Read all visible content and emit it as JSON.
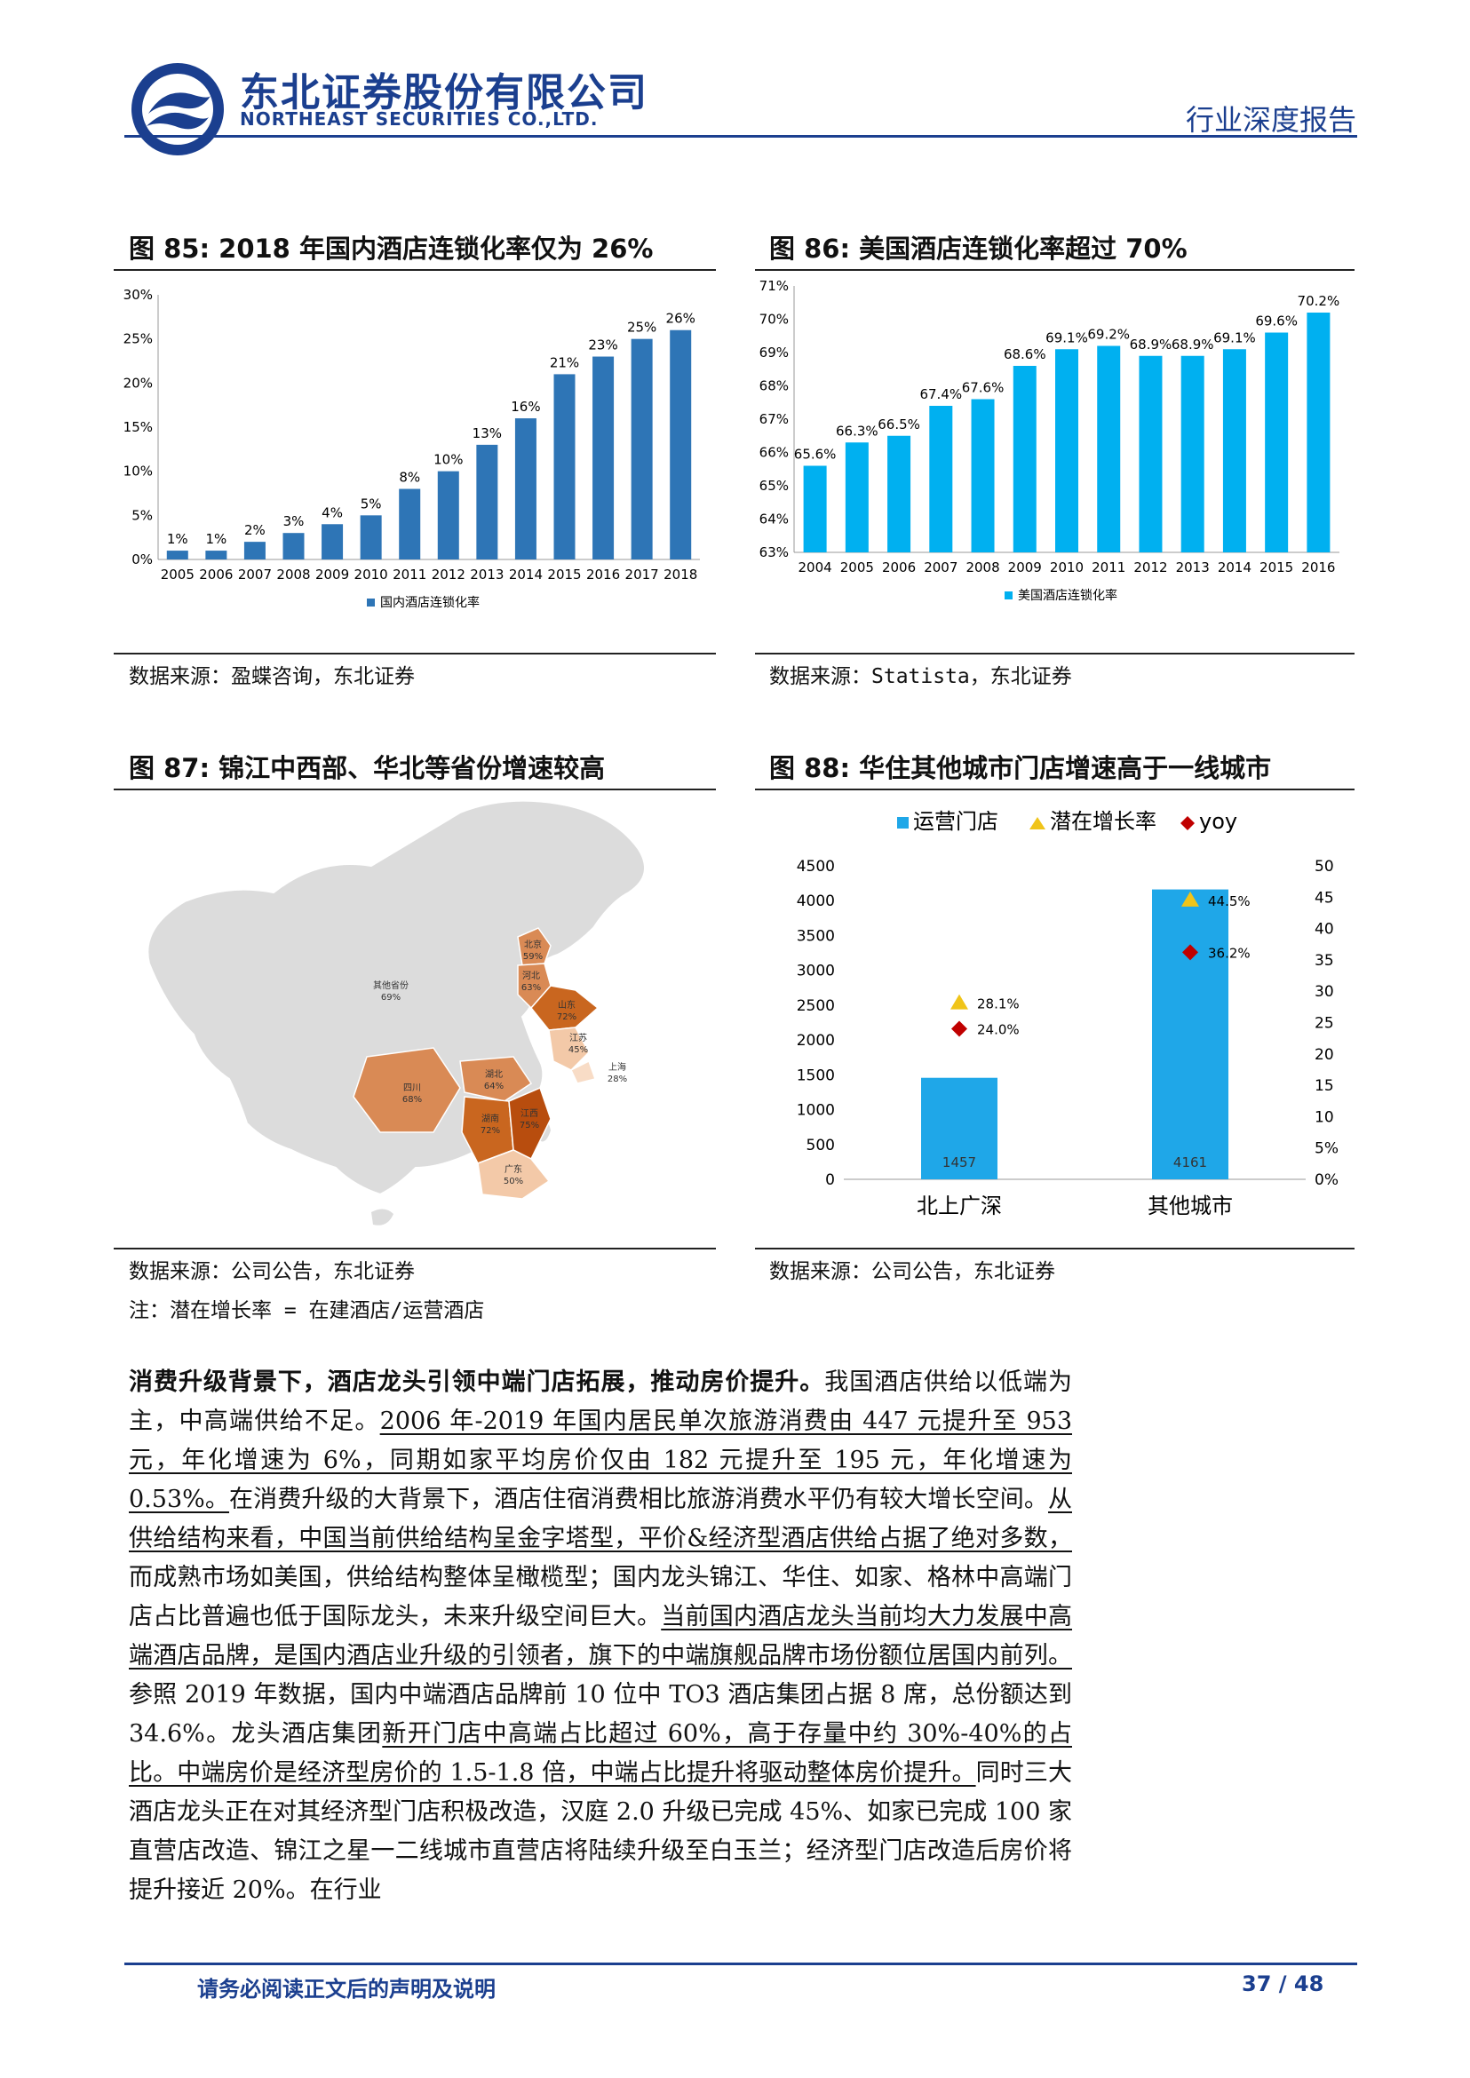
{
  "header": {
    "company_cn": "东北证券股份有限公司",
    "company_en": "NORTHEAST SECURITIES CO.,LTD.",
    "report_type": "行业深度报告",
    "brand_color": "#1b3f8f",
    "logo_icon": "northeast-securities-logo"
  },
  "fig85": {
    "title": "图 85: 2018 年国内酒店连锁化率仅为 26%",
    "source": "数据来源：盈蝶咨询，东北证券"
  },
  "fig86": {
    "title": "图 86: 美国酒店连锁化率超过 70%",
    "source": "数据来源：Statista，东北证券"
  },
  "fig87": {
    "title": "图 87: 锦江中西部、华北等省份增速较高",
    "source": "数据来源：公司公告，东北证券",
    "note": "注：潜在增长率 = 在建酒店/运营酒店",
    "regions": [
      {
        "name": "北京",
        "value": "59%",
        "color": "#d98a55"
      },
      {
        "name": "河北",
        "value": "63%",
        "color": "#d98a55"
      },
      {
        "name": "山东",
        "value": "72%",
        "color": "#c9661f"
      },
      {
        "name": "江苏",
        "value": "45%",
        "color": "#f3c9a8"
      },
      {
        "name": "上海",
        "value": "28%",
        "color": "#f8dcc6"
      },
      {
        "name": "其他省份",
        "value": "69%",
        "color": "#dcdcdc"
      },
      {
        "name": "四川",
        "value": "68%",
        "color": "#d98a55"
      },
      {
        "name": "湖北",
        "value": "64%",
        "color": "#d98a55"
      },
      {
        "name": "湖南",
        "value": "72%",
        "color": "#c9661f"
      },
      {
        "name": "江西",
        "value": "75%",
        "color": "#b84d0e"
      },
      {
        "name": "广东",
        "value": "50%",
        "color": "#f3c9a8"
      }
    ]
  },
  "fig88": {
    "title": "图 88: 华住其他城市门店增速高于一线城市",
    "source": "数据来源：公司公告，东北证券"
  },
  "chart_data": [
    {
      "type": "bar",
      "categories": [
        "2005",
        "2006",
        "2007",
        "2008",
        "2009",
        "2010",
        "2011",
        "2012",
        "2013",
        "2014",
        "2015",
        "2016",
        "2017",
        "2018"
      ],
      "series": [
        {
          "name": "国内酒店连锁化率",
          "values": [
            1,
            1,
            2,
            3,
            4,
            5,
            8,
            10,
            13,
            16,
            21,
            23,
            25,
            26
          ]
        }
      ],
      "data_labels": [
        "1%",
        "1%",
        "2%",
        "3%",
        "4%",
        "5%",
        "8%",
        "10%",
        "13%",
        "16%",
        "21%",
        "23%",
        "25%",
        "26%"
      ],
      "ylim": [
        0,
        30
      ],
      "yticks": [
        "0%",
        "5%",
        "10%",
        "15%",
        "20%",
        "25%",
        "30%"
      ],
      "color": "#2e75b6",
      "legend": "bottom-center",
      "grid": false
    },
    {
      "type": "bar",
      "categories": [
        "2004",
        "2005",
        "2006",
        "2007",
        "2008",
        "2009",
        "2010",
        "2011",
        "2012",
        "2013",
        "2014",
        "2015",
        "2016"
      ],
      "series": [
        {
          "name": "美国酒店连锁化率",
          "values": [
            65.6,
            66.3,
            66.5,
            67.4,
            67.6,
            68.6,
            69.1,
            69.2,
            68.9,
            68.9,
            69.1,
            69.6,
            70.2
          ]
        }
      ],
      "data_labels": [
        "65.6%",
        "66.3%",
        "66.5%",
        "67.4%",
        "67.6%",
        "68.6%",
        "69.1%",
        "69.2%",
        "68.9%",
        "68.9%",
        "69.1%",
        "69.6%",
        "70.2%"
      ],
      "ylim": [
        63,
        71
      ],
      "yticks": [
        "63%",
        "64%",
        "65%",
        "66%",
        "67%",
        "68%",
        "69%",
        "70%",
        "71%"
      ],
      "color": "#00b0f0",
      "legend": "bottom-center",
      "grid": false
    },
    {
      "type": "bar",
      "categories": [
        "北上广深",
        "其他城市"
      ],
      "series": [
        {
          "name": "运营门店",
          "values": [
            1457,
            4161
          ],
          "labels": [
            "1457",
            "4161"
          ],
          "color": "#1fa7e8"
        },
        {
          "name": "潜在增长率",
          "values": [
            28.1,
            44.5
          ],
          "labels": [
            "28.1%",
            "44.5%"
          ],
          "color": "#f0c419",
          "marker": "triangle",
          "axis": "right"
        },
        {
          "name": "yoy",
          "values": [
            24.0,
            36.2
          ],
          "labels": [
            "24.0%",
            "36.2%"
          ],
          "color": "#c00000",
          "marker": "diamond",
          "axis": "right"
        }
      ],
      "ylim": [
        0,
        4500
      ],
      "yticks": [
        "0",
        "500",
        "1000",
        "1500",
        "2000",
        "2500",
        "3000",
        "3500",
        "4000",
        "4500"
      ],
      "y2lim": [
        0,
        50
      ],
      "y2ticks": [
        "0%",
        "5%",
        "10",
        "15",
        "20",
        "25",
        "30",
        "35",
        "40",
        "45",
        "50"
      ],
      "legend": "top-center",
      "grid": false
    }
  ]
}
